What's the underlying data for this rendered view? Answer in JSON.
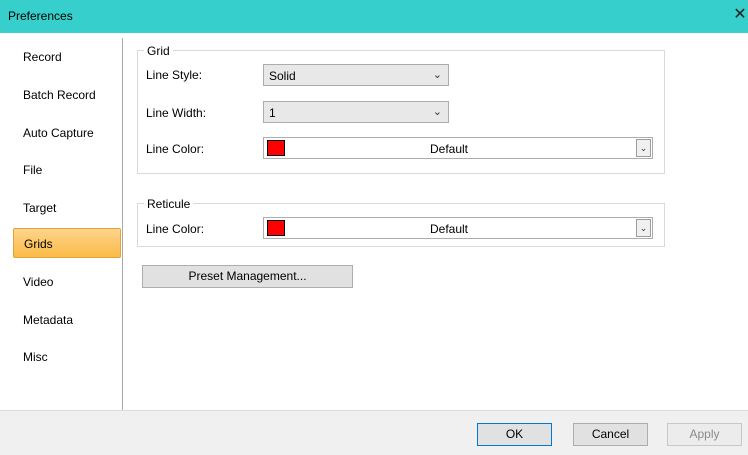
{
  "window": {
    "title": "Preferences",
    "close_glyph": "✕"
  },
  "sidebar": {
    "items": [
      {
        "label": "Record",
        "active": false
      },
      {
        "label": "Batch Record",
        "active": false
      },
      {
        "label": "Auto Capture",
        "active": false
      },
      {
        "label": "File",
        "active": false
      },
      {
        "label": "Target",
        "active": false
      },
      {
        "label": "Grids",
        "active": true
      },
      {
        "label": "Video",
        "active": false
      },
      {
        "label": "Metadata",
        "active": false
      },
      {
        "label": "Misc",
        "active": false
      }
    ]
  },
  "grid": {
    "legend": "Grid",
    "line_style_label": "Line Style:",
    "line_style_value": "Solid",
    "line_width_label": "Line Width:",
    "line_width_value": "1",
    "line_color_label": "Line Color:",
    "line_color_value": "Default",
    "line_color_swatch": "#ff0000"
  },
  "reticule": {
    "legend": "Reticule",
    "line_color_label": "Line Color:",
    "line_color_value": "Default",
    "line_color_swatch": "#ff0000"
  },
  "preset_button": "Preset Management...",
  "footer": {
    "ok": "OK",
    "cancel": "Cancel",
    "apply": "Apply"
  },
  "icons": {
    "chevron": "chevron-down-icon",
    "dropdown": "dropdown-arrow-icon",
    "close": "close-icon"
  },
  "colors": {
    "titlebar": "#37cfcb",
    "active_item": "#fbbb47"
  }
}
